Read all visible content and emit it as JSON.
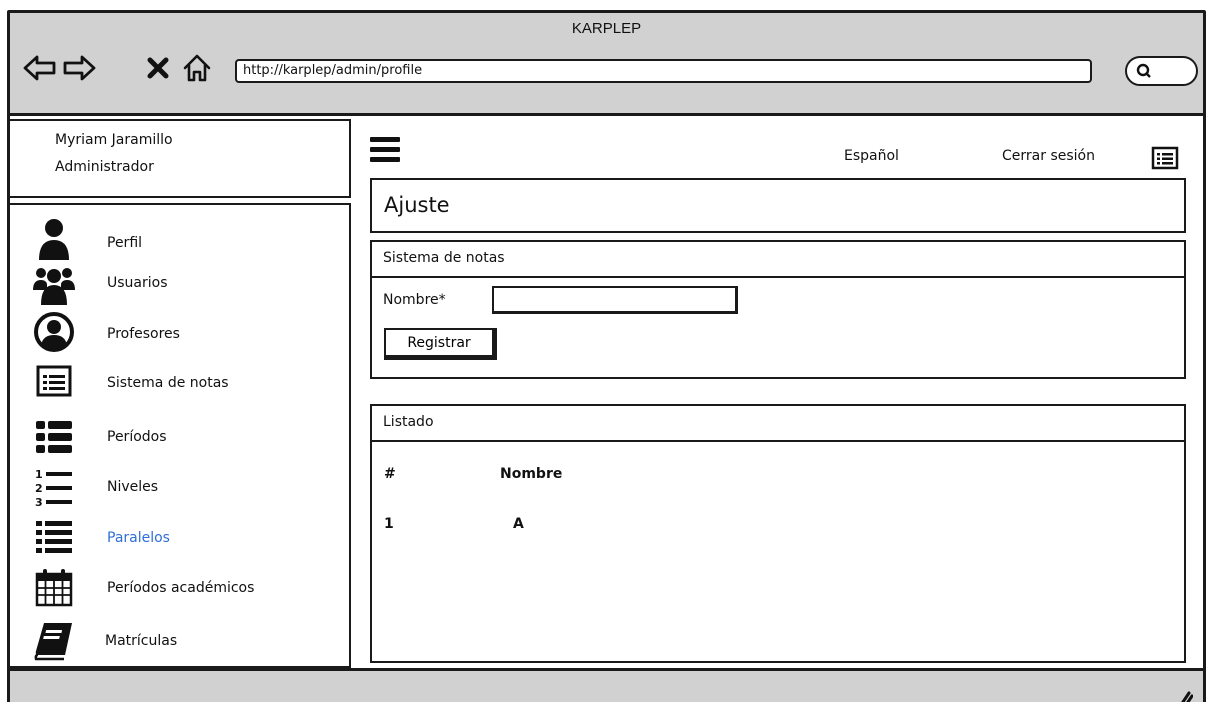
{
  "window": {
    "title": "KARPLEP"
  },
  "browser": {
    "url": "http://karplep/admin/profile",
    "icons": [
      "back-arrow-icon",
      "forward-arrow-icon",
      "close-icon",
      "home-icon",
      "search-icon"
    ]
  },
  "user": {
    "name": "Myriam Jaramillo",
    "role": "Administrador"
  },
  "sidebar": {
    "items": [
      {
        "label": "Perfil",
        "icon": "user-icon"
      },
      {
        "label": "Usuarios",
        "icon": "users-icon"
      },
      {
        "label": "Profesores",
        "icon": "user-circle-icon"
      },
      {
        "label": "Sistema de notas",
        "icon": "list-card-icon"
      },
      {
        "label": "Períodos",
        "icon": "thick-list-icon"
      },
      {
        "label": "Niveles",
        "icon": "numbered-list-icon"
      },
      {
        "label": "Paralelos",
        "icon": "bullet-list-icon",
        "active": true
      },
      {
        "label": "Períodos académicos",
        "icon": "calendar-icon"
      },
      {
        "label": "Matrículas",
        "icon": "book-icon"
      }
    ],
    "active_color": "#2f6fd6"
  },
  "header": {
    "language": "Español",
    "logout": "Cerrar sesión"
  },
  "page": {
    "title": "Ajuste"
  },
  "form_panel": {
    "title": "Sistema de notas",
    "name_label": "Nombre*",
    "name_value": "",
    "submit_label": "Registrar"
  },
  "list_panel": {
    "title": "Listado",
    "columns": [
      "#",
      "Nombre"
    ],
    "rows": [
      [
        "1",
        "A"
      ]
    ]
  }
}
